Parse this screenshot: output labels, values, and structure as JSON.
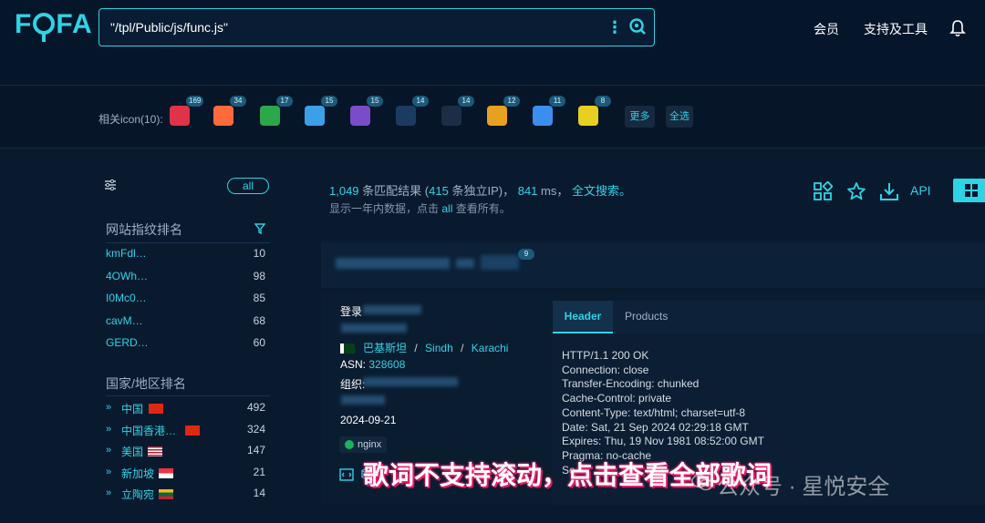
{
  "header": {
    "logo": "FOFA",
    "search_value": "\"/tpl/Public/js/func.js\"",
    "nav": [
      "会员",
      "支持及工具"
    ]
  },
  "icon_row": {
    "label": "相关icon(10):",
    "icons": [
      {
        "count": "169",
        "color": "#e0334a"
      },
      {
        "count": "34",
        "color": "#ff6a3d"
      },
      {
        "count": "17",
        "color": "#2aa84a"
      },
      {
        "count": "15",
        "color": "#3aa0e8"
      },
      {
        "count": "15",
        "color": "#7a4cc8"
      },
      {
        "count": "14",
        "color": "#1b3b60"
      },
      {
        "count": "14",
        "color": "#1a2e45"
      },
      {
        "count": "12",
        "color": "#e8a020"
      },
      {
        "count": "11",
        "color": "#3a8ef0"
      },
      {
        "count": "8",
        "color": "#e8d020"
      }
    ],
    "more": "更多",
    "select_all": "全选"
  },
  "sidebar": {
    "all_label": "all",
    "fingerprint_title": "网站指纹排名",
    "fingerprints": [
      {
        "name": "kmFdl…",
        "count": "10"
      },
      {
        "name": "4OWh…",
        "count": "98"
      },
      {
        "name": "I0Mc0…",
        "count": "85"
      },
      {
        "name": "cavM…",
        "count": "68"
      },
      {
        "name": "GERD…",
        "count": "60"
      }
    ],
    "country_title": "国家/地区排名",
    "countries": [
      {
        "name": "中国",
        "count": "492",
        "flag": "cn"
      },
      {
        "name": "中国香港…",
        "count": "324",
        "flag": "hk"
      },
      {
        "name": "美国",
        "count": "147",
        "flag": "us"
      },
      {
        "name": "新加坡",
        "count": "21",
        "flag": "sg"
      },
      {
        "name": "立陶宛",
        "count": "14",
        "flag": "lt"
      }
    ]
  },
  "results": {
    "total": "1,049",
    "match_text": "条匹配结果",
    "ip_count": "415",
    "ip_text": "条独立IP",
    "ms": "841",
    "ms_unit": "ms",
    "fulltext": "全文搜索。",
    "sub_pre": "显示一年内数据，点击",
    "sub_all": "all",
    "sub_post": "查看所有。",
    "api_label": "API"
  },
  "card": {
    "badge": "9",
    "login_label": "登录",
    "country": "巴基斯坦",
    "region": "Sindh",
    "city": "Karachi",
    "asn_label": "ASN:",
    "asn_value": "328608",
    "org_label": "组织:",
    "date": "2024-09-21",
    "server": "nginx",
    "tab_header": "Header",
    "tab_products": "Products",
    "header_lines": [
      "HTTP/1.1 200 OK",
      "Connection: close",
      "Transfer-Encoding: chunked",
      "Cache-Control: private",
      "Content-Type: text/html; charset=utf-8",
      "Date: Sat, 21 Sep 2024 02:29:18 GMT",
      "Expires: Thu, 19 Nov 1981 08:52:00 GMT",
      "Pragma: no-cache",
      "Se"
    ]
  },
  "overlay": {
    "caption": "歌词不支持滚动，点击查看全部歌词",
    "watermark": "公众号 · 星悦安全"
  },
  "colors": {
    "accent": "#2fd3e6",
    "bg": "#0a1a2e"
  }
}
